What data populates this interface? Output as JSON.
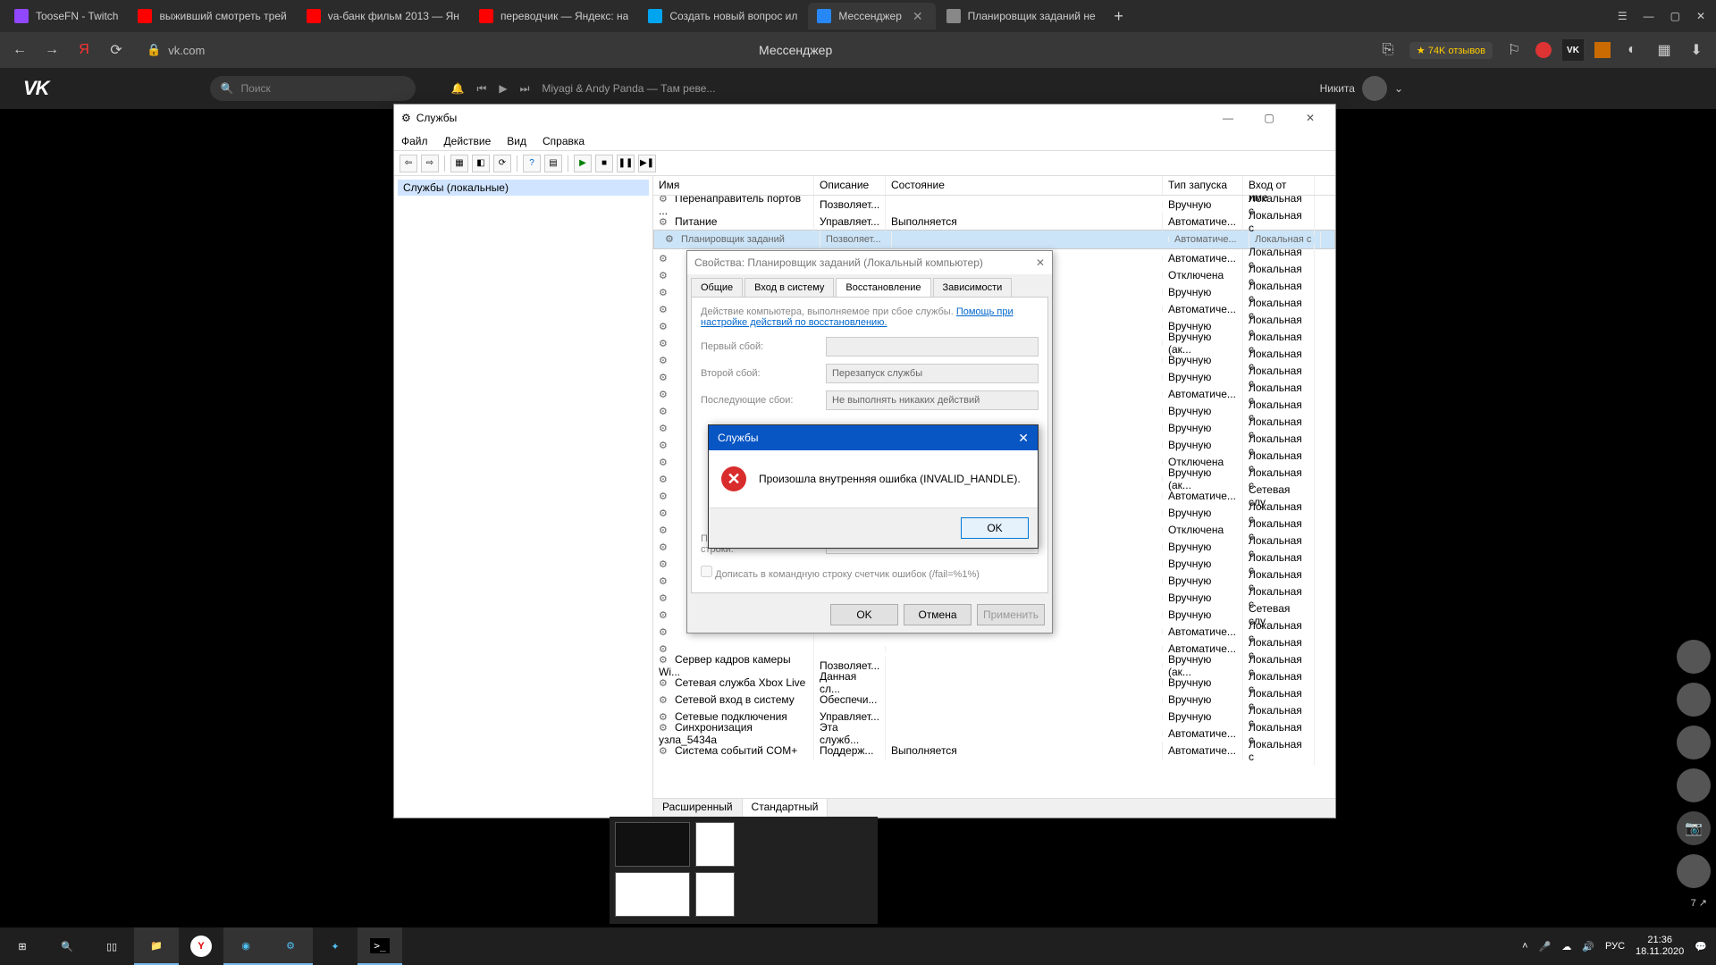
{
  "browser": {
    "tabs": [
      {
        "label": "TooseFN - Twitch",
        "fav": "#9146ff"
      },
      {
        "label": "выживший смотреть трей",
        "fav": "#ff0000"
      },
      {
        "label": "va-банк фильм 2013 — Ян",
        "fav": "#ff0000"
      },
      {
        "label": "переводчик — Яндекс: на",
        "fav": "#ff0000"
      },
      {
        "label": "Создать новый вопрос ил",
        "fav": "#00a4ef"
      },
      {
        "label": "Мессенджер",
        "fav": "#2787f5",
        "active": true
      },
      {
        "label": "Планировщик заданий не",
        "fav": "#888"
      }
    ],
    "url": "vk.com",
    "page_title": "Мессенджер",
    "reviews": "★ 74K отзывов"
  },
  "vk": {
    "logo": "VK",
    "search_placeholder": "Поиск",
    "track": "Miyagi & Andy Panda — Там реве...",
    "user": "Никита"
  },
  "svc": {
    "title": "Службы",
    "menu": [
      "Файл",
      "Действие",
      "Вид",
      "Справка"
    ],
    "tree": "Службы (локальные)",
    "cols": {
      "name": "Имя",
      "desc": "Описание",
      "state": "Состояние",
      "start": "Тип запуска",
      "logon": "Вход от име"
    },
    "rows": [
      {
        "n": "Перенаправитель портов ...",
        "d": "Позволяет...",
        "s": "",
        "t": "Вручную",
        "l": "Локальная с"
      },
      {
        "n": "Питание",
        "d": "Управляет...",
        "s": "Выполняется",
        "t": "Автоматиче...",
        "l": "Локальная с"
      },
      {
        "n": "Планировщик заданий",
        "d": "Позволяет...",
        "s": "",
        "t": "Автоматиче...",
        "l": "Локальная с",
        "sel": true
      },
      {
        "n": "",
        "d": "",
        "s": "",
        "t": "Автоматиче...",
        "l": "Локальная с"
      },
      {
        "n": "",
        "d": "",
        "s": "",
        "t": "Отключена",
        "l": "Локальная с"
      },
      {
        "n": "",
        "d": "",
        "s": "",
        "t": "Вручную",
        "l": "Локальная с"
      },
      {
        "n": "",
        "d": "",
        "s": "",
        "t": "Автоматиче...",
        "l": "Локальная с"
      },
      {
        "n": "",
        "d": "",
        "s": "",
        "t": "Вручную",
        "l": "Локальная с"
      },
      {
        "n": "",
        "d": "",
        "s": "",
        "t": "Вручную (ак...",
        "l": "Локальная с"
      },
      {
        "n": "",
        "d": "",
        "s": "",
        "t": "Вручную",
        "l": "Локальная с"
      },
      {
        "n": "",
        "d": "",
        "s": "",
        "t": "Вручную",
        "l": "Локальная с"
      },
      {
        "n": "",
        "d": "",
        "s": "",
        "t": "Автоматиче...",
        "l": "Локальная с"
      },
      {
        "n": "",
        "d": "",
        "s": "",
        "t": "Вручную",
        "l": "Локальная с"
      },
      {
        "n": "",
        "d": "",
        "s": "",
        "t": "Вручную",
        "l": "Локальная с"
      },
      {
        "n": "",
        "d": "",
        "s": "",
        "t": "Вручную",
        "l": "Локальная с"
      },
      {
        "n": "",
        "d": "",
        "s": "",
        "t": "Отключена",
        "l": "Локальная с"
      },
      {
        "n": "",
        "d": "",
        "s": "",
        "t": "Вручную (ак...",
        "l": "Локальная с"
      },
      {
        "n": "",
        "d": "",
        "s": "",
        "t": "Автоматиче...",
        "l": "Сетевая слу"
      },
      {
        "n": "",
        "d": "",
        "s": "",
        "t": "Вручную",
        "l": "Локальная с"
      },
      {
        "n": "",
        "d": "",
        "s": "",
        "t": "Отключена",
        "l": "Локальная с"
      },
      {
        "n": "",
        "d": "",
        "s": "",
        "t": "Вручную",
        "l": "Локальная с"
      },
      {
        "n": "",
        "d": "",
        "s": "",
        "t": "Вручную",
        "l": "Локальная с"
      },
      {
        "n": "",
        "d": "",
        "s": "",
        "t": "Вручную",
        "l": "Локальная с"
      },
      {
        "n": "",
        "d": "",
        "s": "",
        "t": "Вручную",
        "l": "Локальная с"
      },
      {
        "n": "",
        "d": "",
        "s": "",
        "t": "Вручную",
        "l": "Сетевая слу"
      },
      {
        "n": "",
        "d": "",
        "s": "",
        "t": "Автоматиче...",
        "l": "Локальная с"
      },
      {
        "n": "",
        "d": "",
        "s": "",
        "t": "Автоматиче...",
        "l": "Локальная с"
      },
      {
        "n": "Сервер кадров камеры Wi...",
        "d": "Позволяет...",
        "s": "",
        "t": "Вручную (ак...",
        "l": "Локальная с"
      },
      {
        "n": "Сетевая служба Xbox Live",
        "d": "Данная сл...",
        "s": "",
        "t": "Вручную",
        "l": "Локальная с"
      },
      {
        "n": "Сетевой вход в систему",
        "d": "Обеспечи...",
        "s": "",
        "t": "Вручную",
        "l": "Локальная с"
      },
      {
        "n": "Сетевые подключения",
        "d": "Управляет...",
        "s": "",
        "t": "Вручную",
        "l": "Локальная с"
      },
      {
        "n": "Синхронизация узла_5434a",
        "d": "Эта служб...",
        "s": "",
        "t": "Автоматиче...",
        "l": "Локальная с"
      },
      {
        "n": "Система событий COM+",
        "d": "Поддерж...",
        "s": "Выполняется",
        "t": "Автоматиче...",
        "l": "Локальная с"
      }
    ],
    "tabs": {
      "ext": "Расширенный",
      "std": "Стандартный"
    }
  },
  "prop": {
    "title": "Свойства: Планировщик заданий (Локальный компьютер)",
    "tabs": [
      "Общие",
      "Вход в систему",
      "Восстановление",
      "Зависимости"
    ],
    "help_prefix": "Действие компьютера, выполняемое при сбое службы. ",
    "help_link": "Помощь при настройке действий по восстановлению.",
    "f1": "Первый сбой:",
    "f2": "Второй сбой:",
    "v2": "Перезапуск службы",
    "f3": "Последующие сбои:",
    "v3": "Не выполнять никаких действий",
    "cmdline": "Параметры командной строки:",
    "checkbox": "Дописать в командную строку счетчик ошибок (/fail=%1%)",
    "btns": {
      "ok": "OK",
      "cancel": "Отмена",
      "apply": "Применить"
    }
  },
  "err": {
    "title": "Службы",
    "msg": "Произошла внутренняя ошибка (INVALID_HANDLE).",
    "ok": "OK"
  },
  "taskbar": {
    "lang": "РУС",
    "time": "21:36",
    "date": "18.11.2020",
    "badge": "7"
  }
}
